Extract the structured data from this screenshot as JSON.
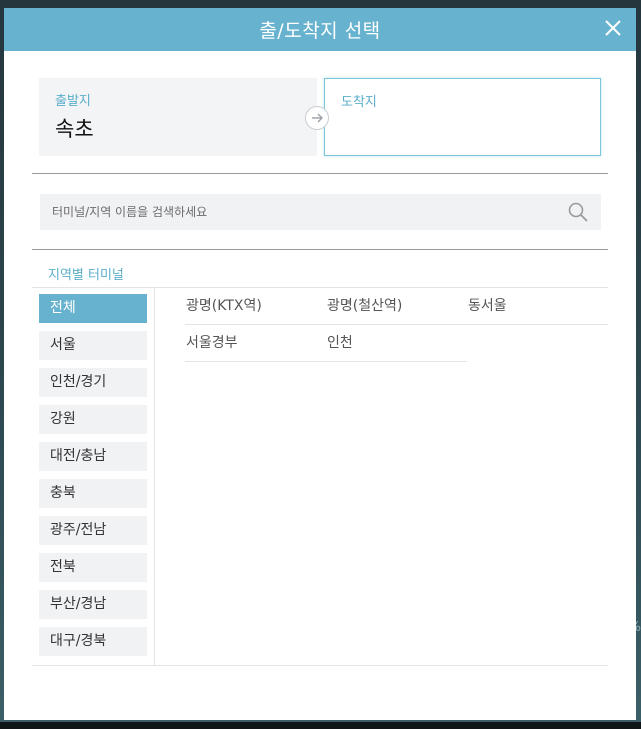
{
  "modal": {
    "title": "출/도착지 선택",
    "close_icon": "close-icon"
  },
  "route": {
    "departure_label": "출발지",
    "departure_value": "속초",
    "arrival_label": "도착지",
    "arrival_value": "",
    "swap_icon": "arrow-right-icon"
  },
  "search": {
    "placeholder": "터미널/지역 이름을 검색하세요",
    "value": "",
    "icon": "search-icon"
  },
  "section": {
    "title": "지역별 터미널"
  },
  "regions": [
    {
      "label": "전체",
      "active": true
    },
    {
      "label": "서울",
      "active": false
    },
    {
      "label": "인천/경기",
      "active": false
    },
    {
      "label": "강원",
      "active": false
    },
    {
      "label": "대전/충남",
      "active": false
    },
    {
      "label": "충북",
      "active": false
    },
    {
      "label": "광주/전남",
      "active": false
    },
    {
      "label": "전북",
      "active": false
    },
    {
      "label": "부산/경남",
      "active": false
    },
    {
      "label": "대구/경북",
      "active": false
    }
  ],
  "terminals": [
    {
      "label": "광명(KTX역)"
    },
    {
      "label": "광명(철산역)"
    },
    {
      "label": "동서울"
    },
    {
      "label": "서울경부"
    },
    {
      "label": "인천"
    }
  ],
  "background": {
    "glyph": "%"
  },
  "colors": {
    "accent": "#67b3cf",
    "label": "#5aaecb",
    "panel": "#f1f2f4"
  }
}
